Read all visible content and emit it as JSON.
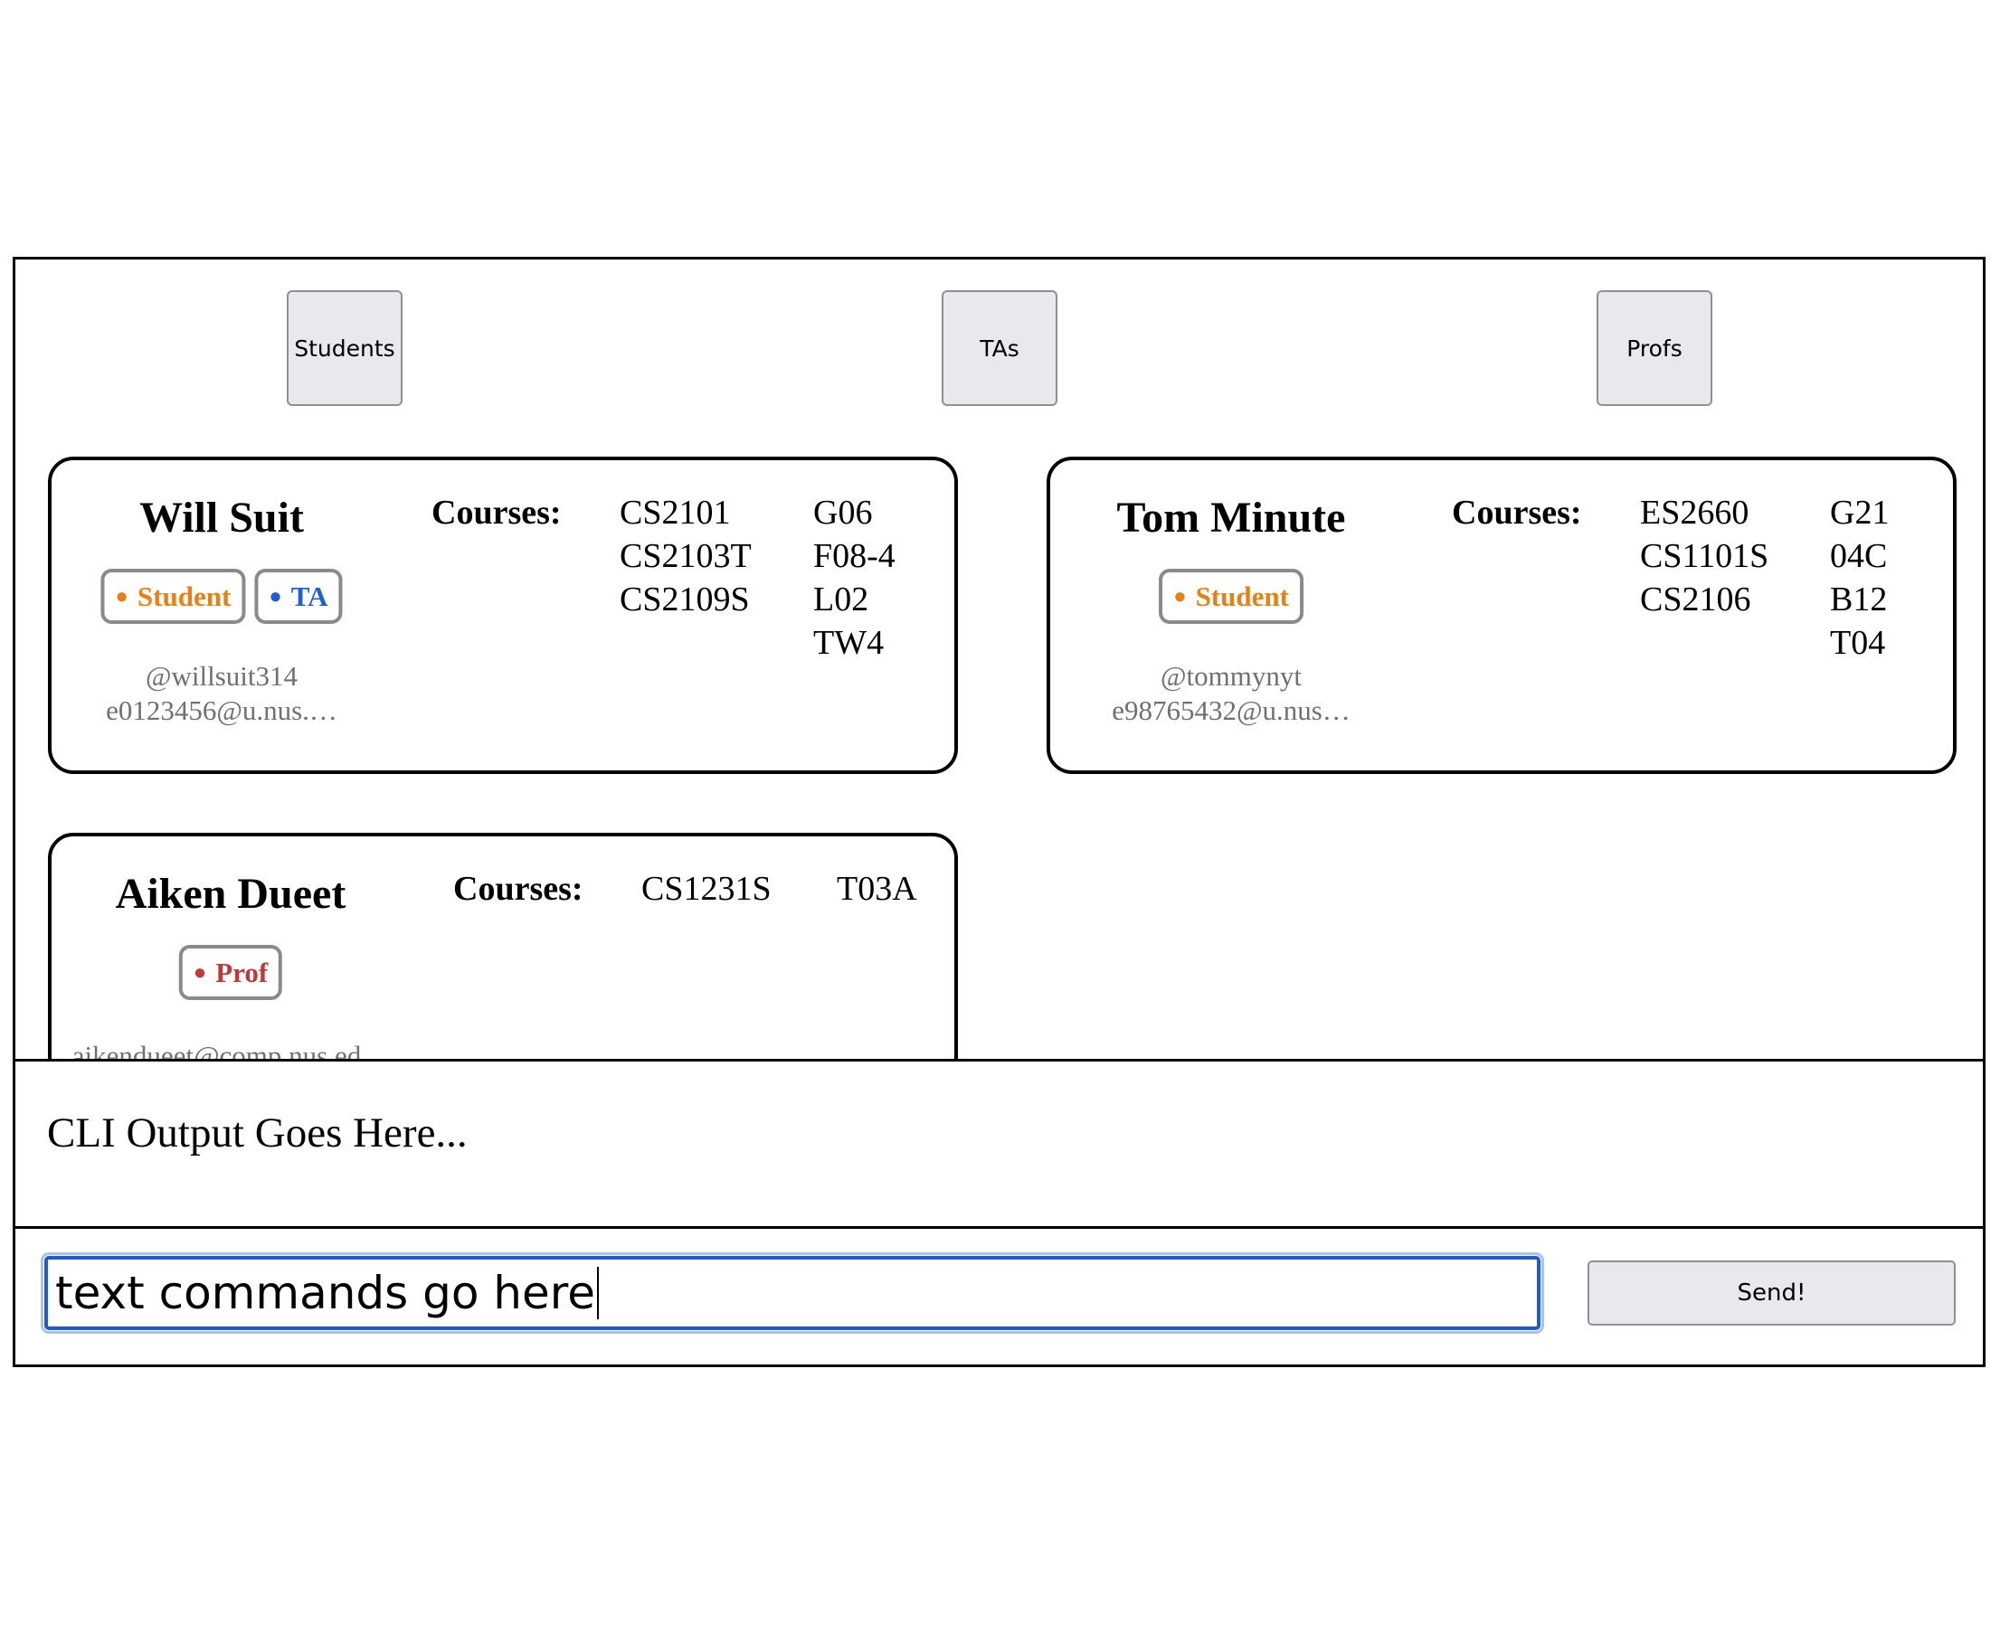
{
  "filters": {
    "students_label": "Students",
    "tas_label": "TAs",
    "profs_label": "Profs"
  },
  "people": [
    {
      "name": "Will Suit",
      "roles": [
        {
          "label": "Student",
          "color": "#e8810f"
        },
        {
          "label": "TA",
          "color": "#1f5fd1"
        }
      ],
      "username": "@willsuit314",
      "email": "e0123456@u.nus.…",
      "courses_label": "Courses:",
      "courses": [
        "CS2101",
        "CS2103T",
        "CS2109S"
      ],
      "groups": [
        "G06",
        "F08-4",
        "L02",
        "TW4"
      ]
    },
    {
      "name": "Tom Minute",
      "roles": [
        {
          "label": "Student",
          "color": "#e8810f"
        }
      ],
      "username": "@tommynyt",
      "email": "e98765432@u.nus…",
      "courses_label": "Courses:",
      "courses": [
        "ES2660",
        "CS1101S",
        "CS2106"
      ],
      "groups": [
        "G21",
        "04C",
        "B12",
        "T04"
      ]
    },
    {
      "name": "Aiken Dueet",
      "roles": [
        {
          "label": "Prof",
          "color": "#c03838"
        }
      ],
      "email": "aikendueet@comp.nus.ed…",
      "courses_label": "Courses:",
      "courses": [
        "CS1231S"
      ],
      "groups": [
        "T03A"
      ]
    }
  ],
  "cli": {
    "output": "CLI Output Goes Here...",
    "input_value": "text commands go here",
    "send_label": "Send!"
  }
}
